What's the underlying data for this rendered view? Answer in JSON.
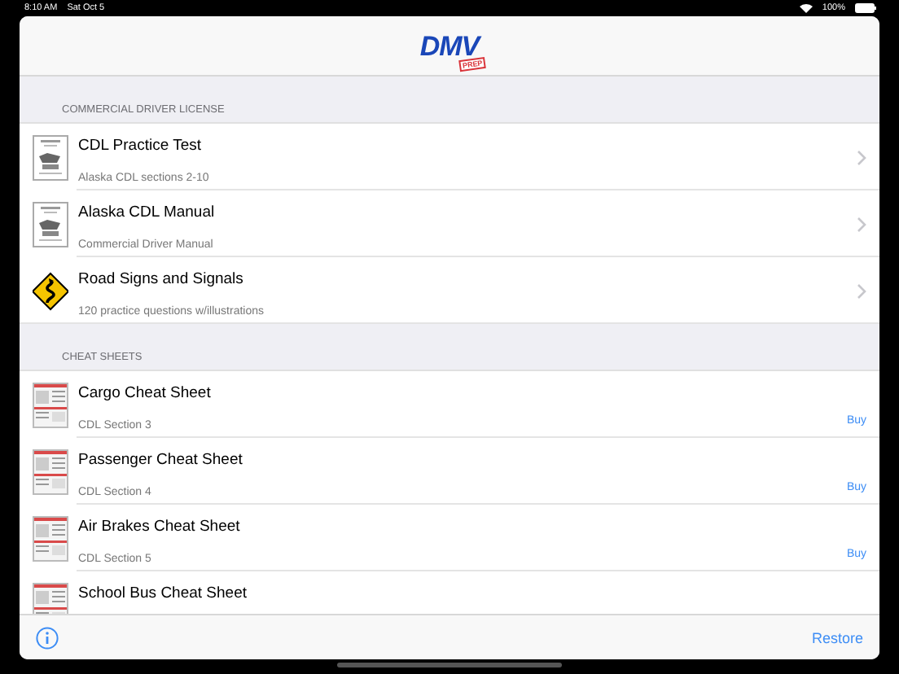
{
  "status_bar": {
    "time": "8:10 AM",
    "date": "Sat Oct 5",
    "battery": "100%"
  },
  "nav_bar": {
    "logo": "DMV",
    "logo_badge": "PREP"
  },
  "sections": [
    {
      "header": "COMMERCIAL DRIVER LICENSE",
      "rows": [
        {
          "title": "CDL Practice Test",
          "subtitle": "Alaska CDL sections 2-10",
          "kind": "manual",
          "accessory": {
            "kind": "chevron"
          }
        },
        {
          "title": "Alaska CDL Manual",
          "subtitle": "Commercial Driver Manual",
          "kind": "manual",
          "accessory": {
            "kind": "chevron"
          }
        },
        {
          "title": "Road Signs and Signals",
          "subtitle": "120 practice questions w/illustrations",
          "kind": "road-sign",
          "accessory": {
            "kind": "chevron"
          }
        }
      ]
    },
    {
      "header": "CHEAT SHEETS",
      "rows": [
        {
          "title": "Cargo Cheat Sheet",
          "subtitle": "CDL Section 3",
          "kind": "sheet",
          "accessory": {
            "kind": "buy",
            "label": "Buy"
          }
        },
        {
          "title": "Passenger Cheat Sheet",
          "subtitle": "CDL Section 4",
          "kind": "sheet",
          "accessory": {
            "kind": "buy",
            "label": "Buy"
          }
        },
        {
          "title": "Air Brakes Cheat Sheet",
          "subtitle": "CDL Section 5",
          "kind": "sheet",
          "accessory": {
            "kind": "buy",
            "label": "Buy"
          }
        },
        {
          "title": "School Bus Cheat Sheet",
          "kind": "sheet"
        }
      ]
    }
  ],
  "toolbar": {
    "right_button": "Restore"
  }
}
